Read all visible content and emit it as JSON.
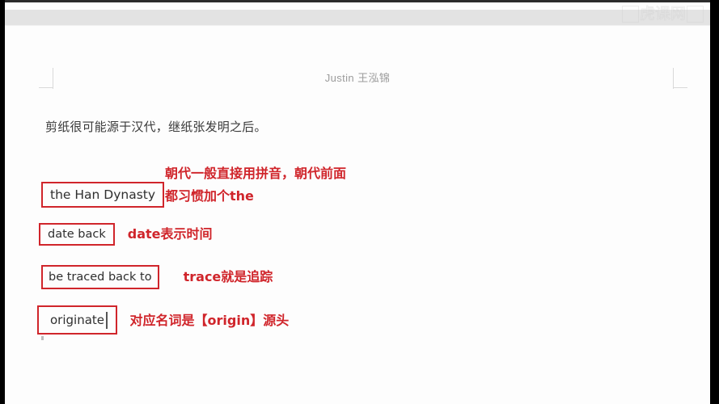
{
  "window": {
    "background_color": "#000000",
    "page_color": "#fdfdfd",
    "accent_color": "#d0252b",
    "body_text_color": "#3a3a3a",
    "header_text_color": "#9b9b9b"
  },
  "watermark": {
    "text": "虎课网",
    "logo_glyph": "回"
  },
  "document": {
    "header": "Justin 王泓锦",
    "body_paragraph": "剪纸很可能源于汉代，继纸张发明之后。"
  },
  "annotations": [
    {
      "term": "the Han Dynasty",
      "note": "朝代一般直接用拼音，朝代前面\n都习惯加个the"
    },
    {
      "term": "date back",
      "note": "date表示时间"
    },
    {
      "term": "be traced back to",
      "note": "trace就是追踪"
    },
    {
      "term": "originate",
      "note": "对应名词是【origin】源头"
    }
  ]
}
